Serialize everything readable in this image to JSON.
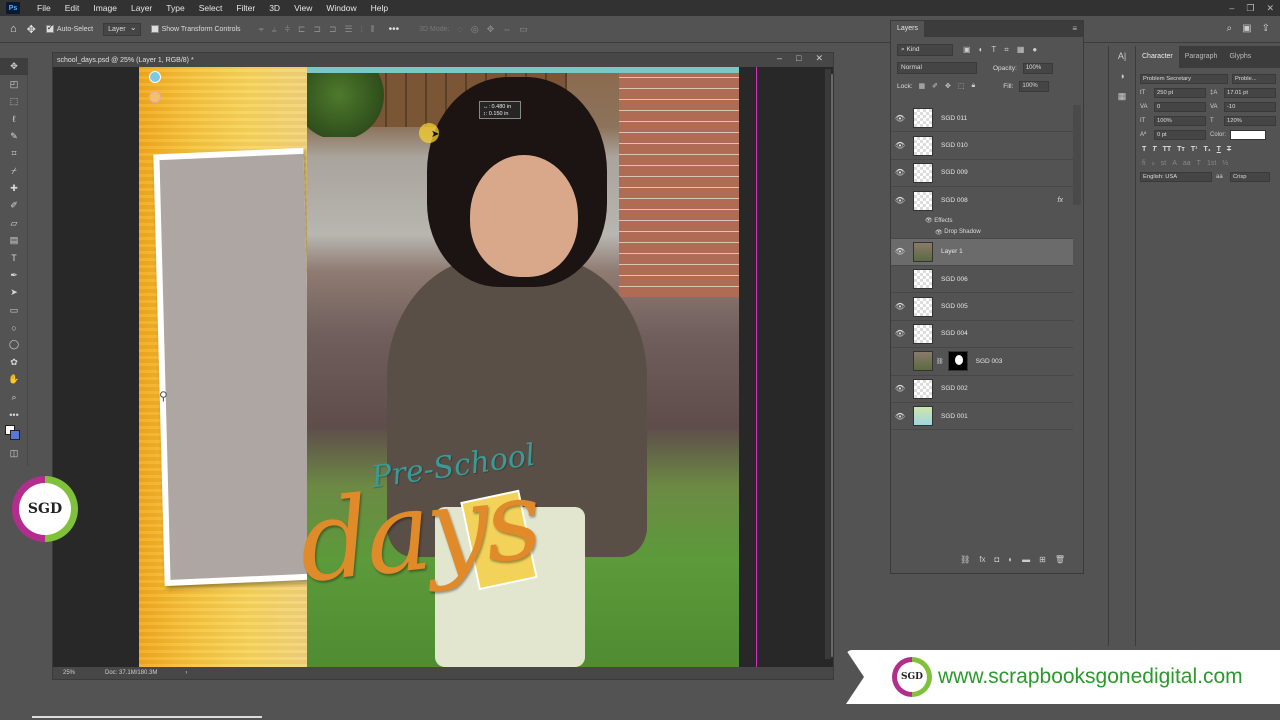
{
  "menu": {
    "logo": "Ps",
    "items": [
      "File",
      "Edit",
      "Image",
      "Layer",
      "Type",
      "Select",
      "Filter",
      "3D",
      "View",
      "Window",
      "Help"
    ]
  },
  "options_bar": {
    "auto_select_label": "Auto-Select",
    "auto_select_checked": true,
    "target_select": "Layer",
    "transform_controls_label": "Show Transform Controls",
    "transform_controls_checked": false,
    "mode_label": "3D Mode:"
  },
  "document": {
    "title": "school_days.psd @ 25% (Layer 1, RGB/8) *",
    "zoom": "25%",
    "doc_info": "Doc: 37.1M/180.3M",
    "tooltip_line1": "↔: 0.480 in",
    "tooltip_line2": "↕: 0.150 in",
    "title_pre": "Pre-School",
    "title_days": "days"
  },
  "layers_panel": {
    "tab": "Layers",
    "filter_kind": "Kind",
    "blend_mode": "Normal",
    "opacity_label": "Opacity:",
    "opacity_value": "100%",
    "lock_label": "Lock:",
    "fill_label": "Fill:",
    "fill_value": "100%",
    "effects_label": "Effects",
    "drop_shadow_label": "Drop Shadow",
    "layers": [
      {
        "name": "SGD 011",
        "visible": true
      },
      {
        "name": "SGD 010",
        "visible": true
      },
      {
        "name": "SGD 009",
        "visible": true
      },
      {
        "name": "SGD 008",
        "visible": true,
        "fx": "fx"
      },
      {
        "name": "Layer 1",
        "visible": true,
        "selected": true
      },
      {
        "name": "SGD 006",
        "visible": false
      },
      {
        "name": "SGD 005",
        "visible": true
      },
      {
        "name": "SGD 004",
        "visible": true
      },
      {
        "name": "SGD 003",
        "visible": false,
        "mask": true
      },
      {
        "name": "SGD 002",
        "visible": true
      },
      {
        "name": "SGD 001",
        "visible": true
      }
    ]
  },
  "character_panel": {
    "tabs": [
      "Character",
      "Paragraph",
      "Glyphs"
    ],
    "font_family": "Problem Secretary",
    "font_style": "Proble...",
    "font_size": "250 pt",
    "leading": "17.01 pt",
    "kerning": "0",
    "tracking": "-10",
    "vertical_scale": "100%",
    "horizontal_scale": "120%",
    "baseline_shift": "0 pt",
    "color_label": "Color:",
    "language": "English: USA",
    "antialias": "Crisp"
  },
  "watermark": {
    "badge": "SGD",
    "url": "www.scrapbooksgonedigital.com"
  },
  "colors": {
    "foreground": "#ffffff",
    "background": "#5677d6",
    "brand_green": "#7fc23a",
    "brand_magenta": "#b22d8d"
  }
}
